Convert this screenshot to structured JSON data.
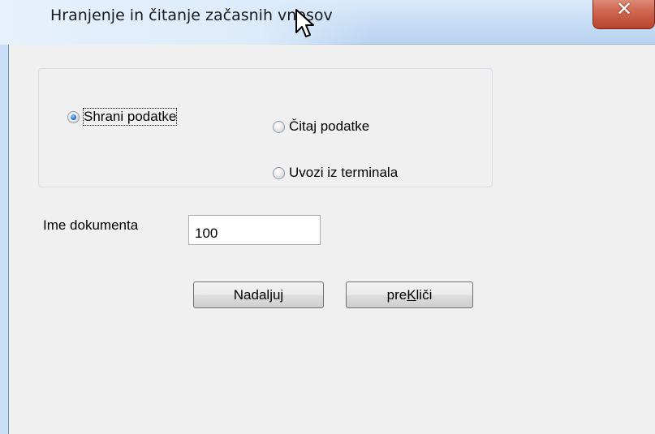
{
  "window": {
    "title": "Hranjenje in čitanje začasnih vnosov"
  },
  "options": [
    {
      "label": "Shrani podatke",
      "checked": true
    },
    {
      "label": "Čitaj podatke",
      "checked": false
    },
    {
      "label": "Uvozi iz terminala",
      "checked": false
    }
  ],
  "document": {
    "label": "Ime dokumenta",
    "value": "100"
  },
  "buttons": {
    "continue_label": "Nadaljuj",
    "cancel_prefix": "pre",
    "cancel_accel": "K",
    "cancel_suffix": "liči"
  },
  "icons": {
    "close": "close-icon",
    "cursor": "mouse-pointer-icon"
  }
}
